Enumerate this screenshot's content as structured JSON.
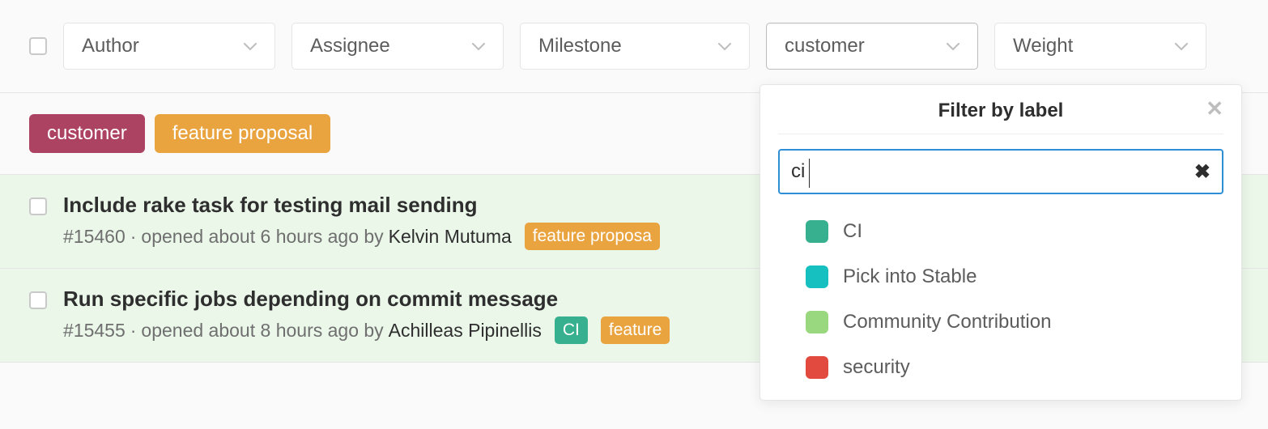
{
  "filters": {
    "author": "Author",
    "assignee": "Assignee",
    "milestone": "Milestone",
    "label": "customer",
    "weight": "Weight"
  },
  "active_labels": {
    "customer": "customer",
    "feature_proposal": "feature proposal"
  },
  "issues": [
    {
      "title": "Include rake task for testing mail sending",
      "id": "#15460",
      "sep": " · ",
      "opened": "opened about 6 hours ago by ",
      "author": "Kelvin Mutuma",
      "labels": [
        {
          "text": "feature proposa",
          "cls": "ml-feature"
        }
      ]
    },
    {
      "title": "Run specific jobs depending on commit message",
      "id": "#15455",
      "sep": " · ",
      "opened": "opened about 8 hours ago by ",
      "author": "Achilleas Pipinellis",
      "labels": [
        {
          "text": "CI",
          "cls": "ml-ci"
        },
        {
          "text": "feature",
          "cls": "ml-feature"
        }
      ]
    }
  ],
  "popover": {
    "title": "Filter by label",
    "search_value": "ci",
    "items": [
      {
        "name": "CI",
        "color": "#36b08f"
      },
      {
        "name": "Pick into Stable",
        "color": "#16c0c0"
      },
      {
        "name": "Community Contribution",
        "color": "#9ad87f"
      },
      {
        "name": "security",
        "color": "#e24a3f"
      }
    ]
  }
}
